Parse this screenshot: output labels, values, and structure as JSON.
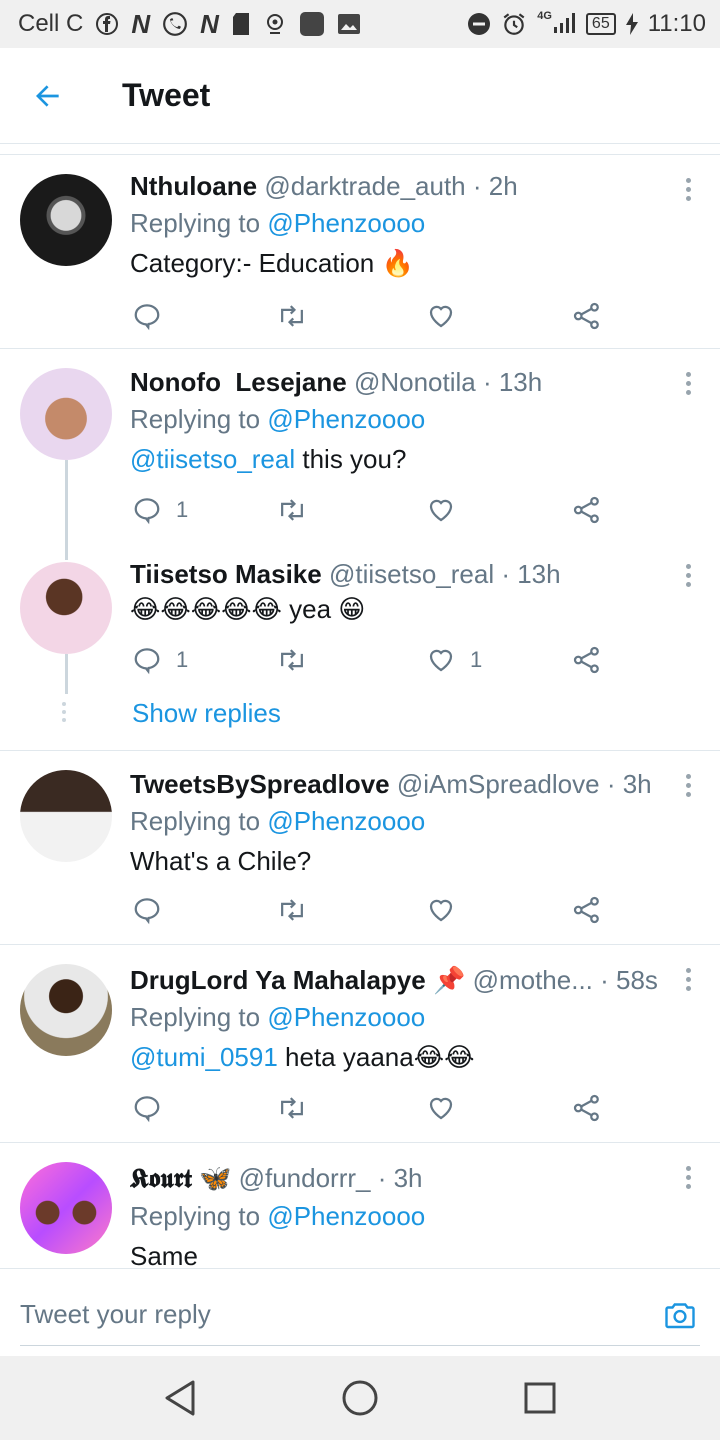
{
  "status_bar": {
    "carrier": "Cell C",
    "network": "4G",
    "battery": "65",
    "time": "11:10"
  },
  "header": {
    "title": "Tweet"
  },
  "tweets": [
    {
      "name": "Nthuloane",
      "handle": "@darktrade_auth",
      "time": "· 2h",
      "replying_prefix": "Replying to ",
      "replying_to": "@Phenzoooo",
      "text": "Category:- Education",
      "text_suffix": "🔥",
      "replies": "",
      "likes": ""
    },
    {
      "name": "Nonofo  Lesejane",
      "handle": "@Nonotila",
      "time": "· 13h",
      "replying_prefix": "Replying to ",
      "replying_to": "@Phenzoooo",
      "mention": "@tiisetso_real",
      "text": " this you?",
      "replies": "1",
      "likes": ""
    },
    {
      "name": "Tiisetso Masike",
      "handle": "@tiisetso_real",
      "time": "· 13h",
      "text_prefix": "😂😂😂😂😂",
      "text": " yea ",
      "text_suffix": "😁",
      "replies": "1",
      "likes": "1"
    },
    {
      "name": "TweetsBySpreadlove",
      "handle": "@iAmSpreadlove",
      "time": "· 3h",
      "replying_prefix": "Replying to ",
      "replying_to": "@Phenzoooo",
      "text": "What's a Chile?",
      "replies": "",
      "likes": ""
    },
    {
      "name": "DrugLord Ya Mahalapye",
      "name_suffix": "📌",
      "handle": "@mothe...",
      "time": "· 58s",
      "replying_prefix": "Replying to ",
      "replying_to": "@Phenzoooo",
      "mention": "@tumi_0591",
      "text": " heta yaana",
      "text_suffix": "😂😂",
      "replies": "",
      "likes": ""
    },
    {
      "name": "𝕶𝖔𝖚𝖗𝖙",
      "name_suffix": "🦋",
      "handle": "@fundorrr_",
      "time": "· 3h",
      "replying_prefix": "Replying to ",
      "replying_to": "@Phenzoooo",
      "text": "Same",
      "replies": "",
      "likes": ""
    }
  ],
  "show_replies": "Show replies",
  "reply_bar": {
    "placeholder": "Tweet your reply"
  },
  "colors": {
    "accent": "#1b95e0",
    "text": "#14171a",
    "secondary": "#657786",
    "divider": "#e1e8ed"
  }
}
